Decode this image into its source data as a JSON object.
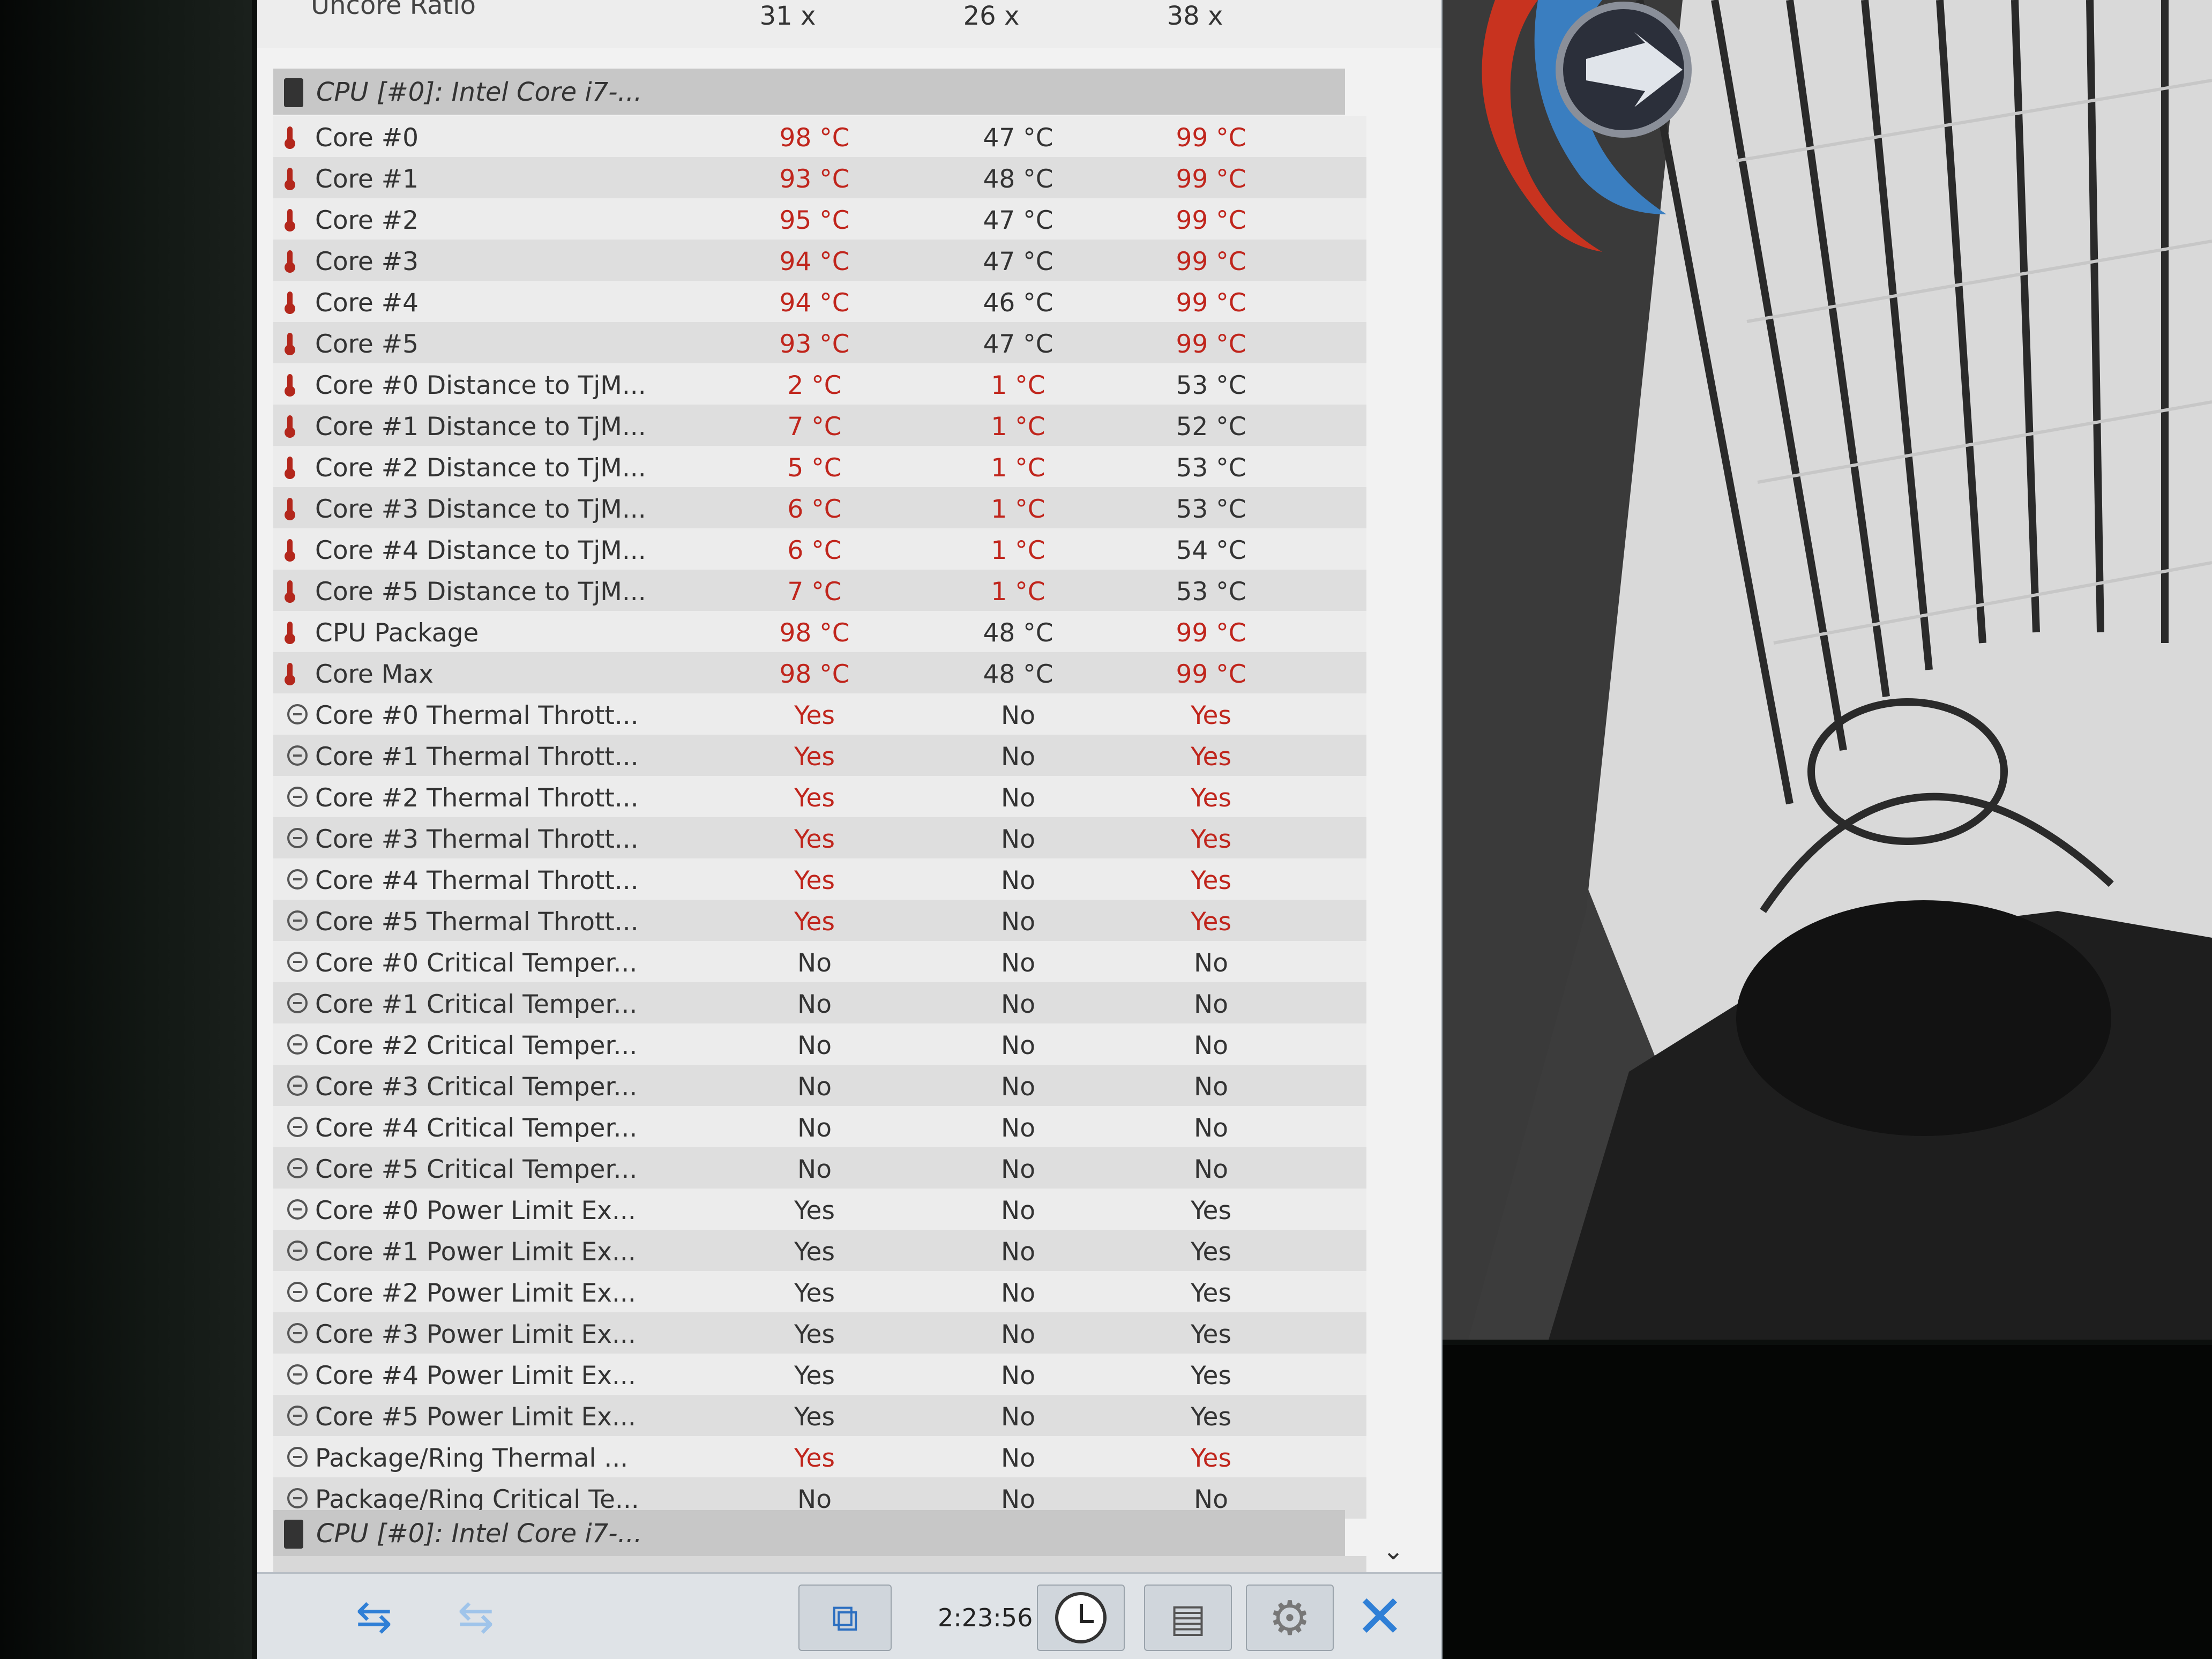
{
  "uncore_row": {
    "label": "Uncore Ratio",
    "values": [
      "31 x",
      "26 x",
      "38 x"
    ]
  },
  "group_header_1": "CPU [#0]: Intel Core i7-...",
  "group_header_2": "CPU [#0]: Intel Core i7-...",
  "rows": [
    {
      "name": "Core #0",
      "icon": "thermometer-icon",
      "v1": "98 °C",
      "v2": "47 °C",
      "v3": "99 °C",
      "r1": true,
      "r2": false,
      "r3": true
    },
    {
      "name": "Core #1",
      "icon": "thermometer-icon",
      "v1": "93 °C",
      "v2": "48 °C",
      "v3": "99 °C",
      "r1": true,
      "r2": false,
      "r3": true
    },
    {
      "name": "Core #2",
      "icon": "thermometer-icon",
      "v1": "95 °C",
      "v2": "47 °C",
      "v3": "99 °C",
      "r1": true,
      "r2": false,
      "r3": true
    },
    {
      "name": "Core #3",
      "icon": "thermometer-icon",
      "v1": "94 °C",
      "v2": "47 °C",
      "v3": "99 °C",
      "r1": true,
      "r2": false,
      "r3": true
    },
    {
      "name": "Core #4",
      "icon": "thermometer-icon",
      "v1": "94 °C",
      "v2": "46 °C",
      "v3": "99 °C",
      "r1": true,
      "r2": false,
      "r3": true
    },
    {
      "name": "Core #5",
      "icon": "thermometer-icon",
      "v1": "93 °C",
      "v2": "47 °C",
      "v3": "99 °C",
      "r1": true,
      "r2": false,
      "r3": true
    },
    {
      "name": "Core #0 Distance to TjM...",
      "icon": "thermometer-icon",
      "v1": "2 °C",
      "v2": "1 °C",
      "v3": "53 °C",
      "r1": true,
      "r2": true,
      "r3": false
    },
    {
      "name": "Core #1 Distance to TjM...",
      "icon": "thermometer-icon",
      "v1": "7 °C",
      "v2": "1 °C",
      "v3": "52 °C",
      "r1": true,
      "r2": true,
      "r3": false
    },
    {
      "name": "Core #2 Distance to TjM...",
      "icon": "thermometer-icon",
      "v1": "5 °C",
      "v2": "1 °C",
      "v3": "53 °C",
      "r1": true,
      "r2": true,
      "r3": false
    },
    {
      "name": "Core #3 Distance to TjM...",
      "icon": "thermometer-icon",
      "v1": "6 °C",
      "v2": "1 °C",
      "v3": "53 °C",
      "r1": true,
      "r2": true,
      "r3": false
    },
    {
      "name": "Core #4 Distance to TjM...",
      "icon": "thermometer-icon",
      "v1": "6 °C",
      "v2": "1 °C",
      "v3": "54 °C",
      "r1": true,
      "r2": true,
      "r3": false
    },
    {
      "name": "Core #5 Distance to TjM...",
      "icon": "thermometer-icon",
      "v1": "7 °C",
      "v2": "1 °C",
      "v3": "53 °C",
      "r1": true,
      "r2": true,
      "r3": false
    },
    {
      "name": "CPU Package",
      "icon": "thermometer-icon",
      "v1": "98 °C",
      "v2": "48 °C",
      "v3": "99 °C",
      "r1": true,
      "r2": false,
      "r3": true
    },
    {
      "name": "Core Max",
      "icon": "thermometer-icon",
      "v1": "98 °C",
      "v2": "48 °C",
      "v3": "99 °C",
      "r1": true,
      "r2": false,
      "r3": true
    },
    {
      "name": "Core #0 Thermal Thrott...",
      "icon": "clock-icon",
      "v1": "Yes",
      "v2": "No",
      "v3": "Yes",
      "r1": true,
      "r2": false,
      "r3": true
    },
    {
      "name": "Core #1 Thermal Thrott...",
      "icon": "clock-icon",
      "v1": "Yes",
      "v2": "No",
      "v3": "Yes",
      "r1": true,
      "r2": false,
      "r3": true
    },
    {
      "name": "Core #2 Thermal Thrott...",
      "icon": "clock-icon",
      "v1": "Yes",
      "v2": "No",
      "v3": "Yes",
      "r1": true,
      "r2": false,
      "r3": true
    },
    {
      "name": "Core #3 Thermal Thrott...",
      "icon": "clock-icon",
      "v1": "Yes",
      "v2": "No",
      "v3": "Yes",
      "r1": true,
      "r2": false,
      "r3": true
    },
    {
      "name": "Core #4 Thermal Thrott...",
      "icon": "clock-icon",
      "v1": "Yes",
      "v2": "No",
      "v3": "Yes",
      "r1": true,
      "r2": false,
      "r3": true
    },
    {
      "name": "Core #5 Thermal Thrott...",
      "icon": "clock-icon",
      "v1": "Yes",
      "v2": "No",
      "v3": "Yes",
      "r1": true,
      "r2": false,
      "r3": true
    },
    {
      "name": "Core #0 Critical Temper...",
      "icon": "clock-icon",
      "v1": "No",
      "v2": "No",
      "v3": "No",
      "r1": false,
      "r2": false,
      "r3": false
    },
    {
      "name": "Core #1 Critical Temper...",
      "icon": "clock-icon",
      "v1": "No",
      "v2": "No",
      "v3": "No",
      "r1": false,
      "r2": false,
      "r3": false
    },
    {
      "name": "Core #2 Critical Temper...",
      "icon": "clock-icon",
      "v1": "No",
      "v2": "No",
      "v3": "No",
      "r1": false,
      "r2": false,
      "r3": false
    },
    {
      "name": "Core #3 Critical Temper...",
      "icon": "clock-icon",
      "v1": "No",
      "v2": "No",
      "v3": "No",
      "r1": false,
      "r2": false,
      "r3": false
    },
    {
      "name": "Core #4 Critical Temper...",
      "icon": "clock-icon",
      "v1": "No",
      "v2": "No",
      "v3": "No",
      "r1": false,
      "r2": false,
      "r3": false
    },
    {
      "name": "Core #5 Critical Temper...",
      "icon": "clock-icon",
      "v1": "No",
      "v2": "No",
      "v3": "No",
      "r1": false,
      "r2": false,
      "r3": false
    },
    {
      "name": "Core #0 Power Limit Ex...",
      "icon": "clock-icon",
      "v1": "Yes",
      "v2": "No",
      "v3": "Yes",
      "r1": false,
      "r2": false,
      "r3": false
    },
    {
      "name": "Core #1 Power Limit Ex...",
      "icon": "clock-icon",
      "v1": "Yes",
      "v2": "No",
      "v3": "Yes",
      "r1": false,
      "r2": false,
      "r3": false
    },
    {
      "name": "Core #2 Power Limit Ex...",
      "icon": "clock-icon",
      "v1": "Yes",
      "v2": "No",
      "v3": "Yes",
      "r1": false,
      "r2": false,
      "r3": false
    },
    {
      "name": "Core #3 Power Limit Ex...",
      "icon": "clock-icon",
      "v1": "Yes",
      "v2": "No",
      "v3": "Yes",
      "r1": false,
      "r2": false,
      "r3": false
    },
    {
      "name": "Core #4 Power Limit Ex...",
      "icon": "clock-icon",
      "v1": "Yes",
      "v2": "No",
      "v3": "Yes",
      "r1": false,
      "r2": false,
      "r3": false
    },
    {
      "name": "Core #5 Power Limit Ex...",
      "icon": "clock-icon",
      "v1": "Yes",
      "v2": "No",
      "v3": "Yes",
      "r1": false,
      "r2": false,
      "r3": false
    },
    {
      "name": "Package/Ring Thermal ...",
      "icon": "clock-icon",
      "v1": "Yes",
      "v2": "No",
      "v3": "Yes",
      "r1": true,
      "r2": false,
      "r3": true
    },
    {
      "name": "Package/Ring Critical Te...",
      "icon": "clock-icon",
      "v1": "No",
      "v2": "No",
      "v3": "No",
      "r1": false,
      "r2": false,
      "r3": false
    }
  ],
  "toolbar": {
    "timer": "2:23:56",
    "nav_icon": "double-arrow-icon",
    "network_icon": "network-icon",
    "clock_icon": "clock-icon",
    "report_icon": "report-icon",
    "settings_icon": "gear-icon",
    "close_icon": "close-icon"
  },
  "colors": {
    "alert_red": "#c0251c",
    "accent_blue": "#2f7fd6",
    "row_light": "#ececec",
    "row_dark": "#dedede"
  }
}
